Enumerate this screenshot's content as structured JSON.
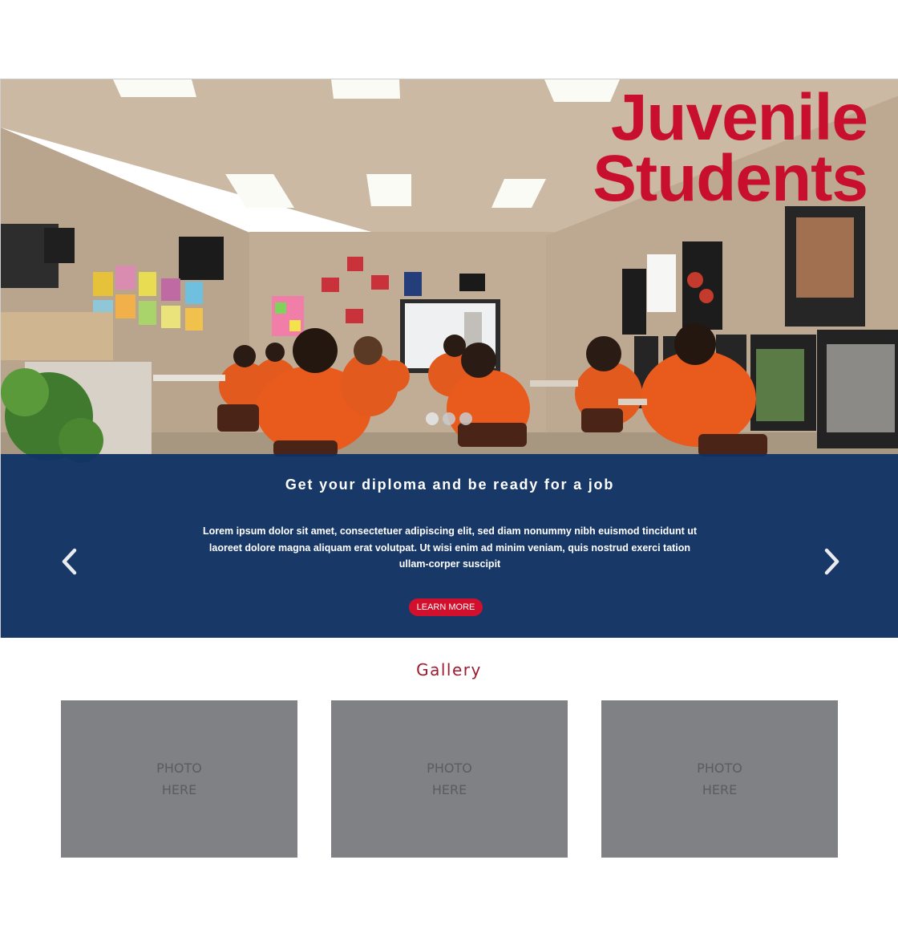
{
  "hero": {
    "title_line1": "Juvenile",
    "title_line2": "Students",
    "carousel": {
      "slides": 3,
      "active_index": 0
    },
    "caption": {
      "heading": "Get your diploma and be ready for a job",
      "body": "Lorem ipsum dolor sit amet, consectetuer adipiscing elit, sed diam nonummy nibh euismod tincidunt ut laoreet dolore magna aliquam erat volutpat. Ut wisi enim ad minim veniam, quis nostrud exerci tation ullam-corper suscipit",
      "button_label": "LEARN MORE"
    },
    "prev_icon": "chevron-left-icon",
    "next_icon": "chevron-right-icon"
  },
  "gallery": {
    "title": "Gallery",
    "photos": [
      {
        "line1": "PHOTO",
        "line2": "HERE"
      },
      {
        "line1": "PHOTO",
        "line2": "HERE"
      },
      {
        "line1": "PHOTO",
        "line2": "HERE"
      }
    ]
  },
  "colors": {
    "title_red": "#c8102e",
    "caption_blue": "#0d3065",
    "button_red": "#d0102c",
    "gallery_title": "#9b1b30",
    "placeholder_gray": "#808184"
  }
}
